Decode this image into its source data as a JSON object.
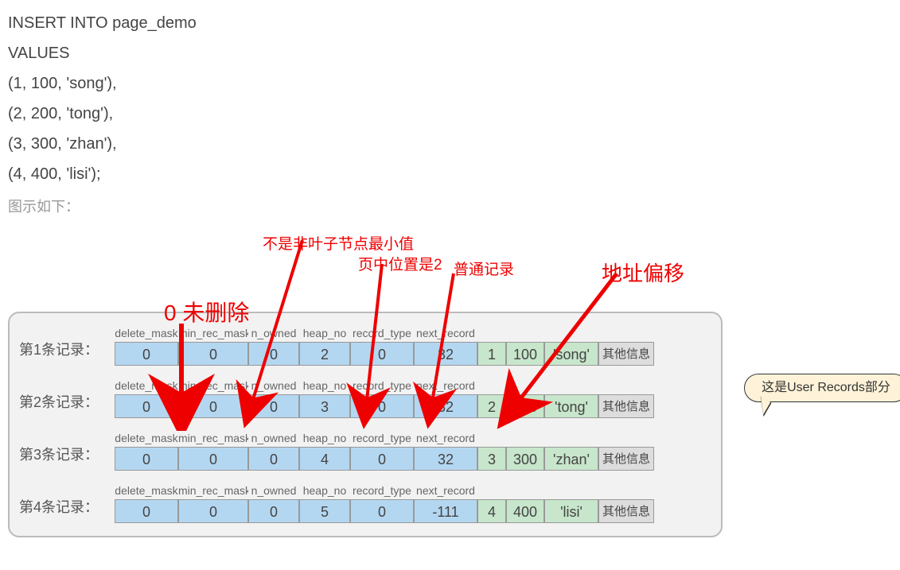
{
  "sql": {
    "lines": [
      "INSERT INTO page_demo",
      "VALUES",
      "(1, 100, 'song'),",
      "(2, 200, 'tong'),",
      "(3, 300, 'zhan'),",
      "(4, 400, 'lisi');"
    ],
    "caption": "图示如下："
  },
  "labels": {
    "not_deleted": "0 未删除",
    "not_min_leaf": "不是非叶子节点最小值",
    "page_position": "页中位置是2",
    "ordinary_record": "普通记录",
    "addr_offset": "地址偏移",
    "bubble": "这是User Records部分"
  },
  "column_headers": {
    "delete_mask": "delete_mask",
    "min_rec_mask": "min_rec_mask",
    "n_owned": "n_owned",
    "heap_no": "heap_no",
    "record_type": "record_type",
    "next_record": "next_record"
  },
  "rows": [
    {
      "label": "第1条记录：",
      "delete_mask": "0",
      "min_rec_mask": "0",
      "n_owned": "0",
      "heap_no": "2",
      "record_type": "0",
      "next_record": "32",
      "id": "1",
      "num": "100",
      "str": "'song'",
      "info": "其他信息"
    },
    {
      "label": "第2条记录：",
      "delete_mask": "0",
      "min_rec_mask": "0",
      "n_owned": "0",
      "heap_no": "3",
      "record_type": "0",
      "next_record": "32",
      "id": "2",
      "num": "200",
      "str": "'tong'",
      "info": "其他信息"
    },
    {
      "label": "第3条记录：",
      "delete_mask": "0",
      "min_rec_mask": "0",
      "n_owned": "0",
      "heap_no": "4",
      "record_type": "0",
      "next_record": "32",
      "id": "3",
      "num": "300",
      "str": "'zhan'",
      "info": "其他信息"
    },
    {
      "label": "第4条记录：",
      "delete_mask": "0",
      "min_rec_mask": "0",
      "n_owned": "0",
      "heap_no": "5",
      "record_type": "0",
      "next_record": "-111",
      "id": "4",
      "num": "400",
      "str": "'lisi'",
      "info": "其他信息"
    }
  ]
}
